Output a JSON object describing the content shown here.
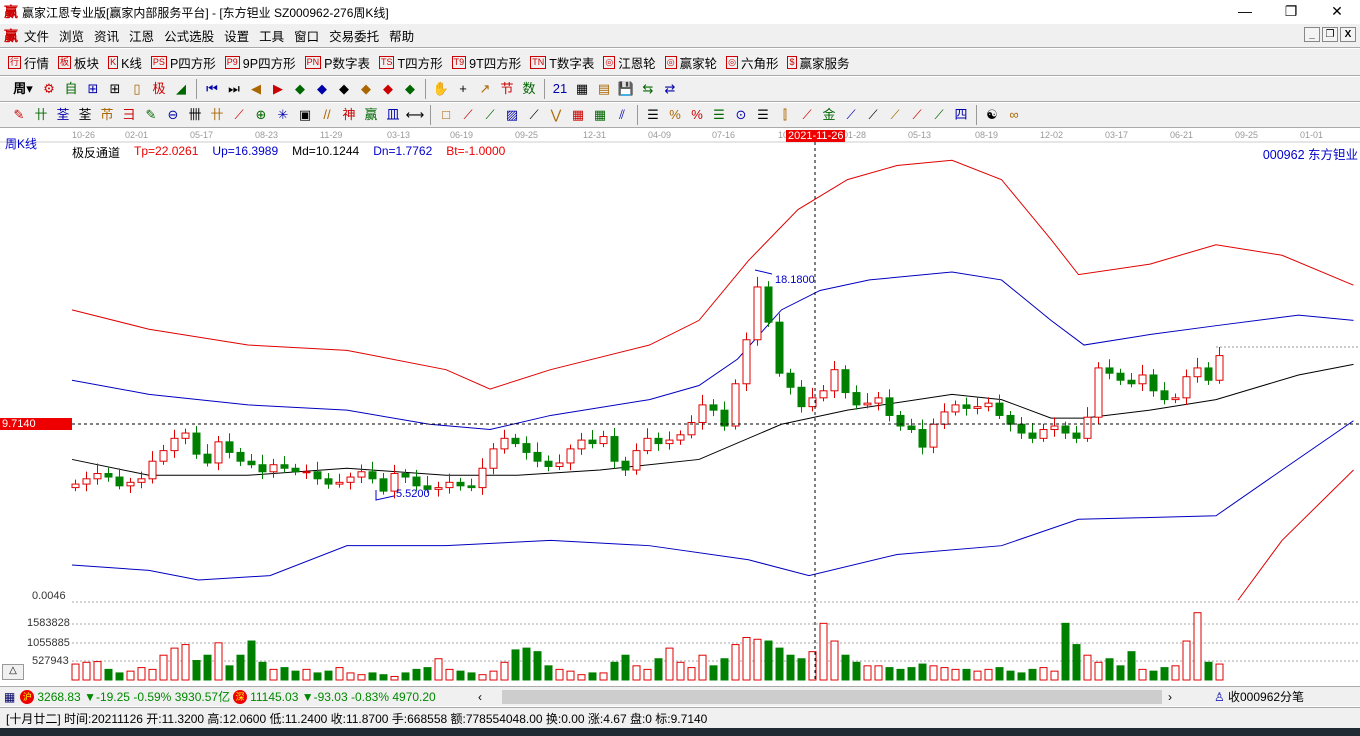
{
  "window": {
    "title": "赢家江恩专业版[赢家内部服务平台] - [东方钽业  SZ000962-276周K线]",
    "min": "—",
    "max": "❐",
    "close": "✕"
  },
  "menu": [
    "文件",
    "浏览",
    "资讯",
    "江恩",
    "公式选股",
    "设置",
    "工具",
    "窗口",
    "交易委托",
    "帮助"
  ],
  "toolbar1": [
    {
      "icon": "行",
      "label": "行情"
    },
    {
      "icon": "板",
      "label": "板块"
    },
    {
      "icon": "K",
      "label": "K线"
    },
    {
      "icon": "PS",
      "label": "P四方形"
    },
    {
      "icon": "P9",
      "label": "9P四方形"
    },
    {
      "icon": "PN",
      "label": "P数字表"
    },
    {
      "icon": "TS",
      "label": "T四方形"
    },
    {
      "icon": "T9",
      "label": "9T四方形"
    },
    {
      "icon": "TN",
      "label": "T数字表"
    },
    {
      "icon": "◎",
      "label": "江恩轮"
    },
    {
      "icon": "◎",
      "label": "赢家轮"
    },
    {
      "icon": "◎",
      "label": "六角形"
    },
    {
      "icon": "$",
      "label": "赢家服务"
    }
  ],
  "toolbar2": {
    "period": "周",
    "icons": [
      "⚙",
      "自",
      "⊞",
      "⊞",
      "▯",
      "极",
      "◢",
      "⏮",
      "⏭",
      "◀",
      "▶",
      "◆",
      "◆",
      "◆",
      "◆",
      "◆",
      "◆",
      "✋",
      "+",
      "↗",
      "节",
      "数",
      "21",
      "▦",
      "▤",
      "💾",
      "⇆",
      "⇄"
    ]
  },
  "toolbar3": {
    "icons": [
      "✎",
      "卄",
      "荃",
      "荃",
      "芇",
      "彐",
      "✎",
      "⊖",
      "卌",
      "卄",
      "⟋",
      "⊕",
      "✳",
      "▣",
      "//",
      "神",
      "赢",
      "皿",
      "⟷",
      "□",
      "⟋",
      "⟋",
      "▨",
      "⟋",
      "⋁",
      "▦",
      "▦",
      "⫽",
      "☰",
      "%",
      "%",
      "☰",
      "⊙",
      "☰",
      "⫿",
      "⟋",
      "金",
      "⟋",
      "⟋",
      "⟋",
      "⟋",
      "⟋",
      "四",
      "☯",
      "∞"
    ]
  },
  "chart": {
    "period_label": "周K线",
    "indicator": "极反通道",
    "tp": "Tp=22.0261",
    "up": "Up=16.3989",
    "md": "Md=10.1244",
    "dn": "Dn=1.7762",
    "bt": "Bt=-1.0000",
    "stock": "000962  东方钽业",
    "cursor_date": "2021-11-26",
    "cursor_price": "9.7140",
    "high_label": "18.1800",
    "low_label": "5.5200",
    "vol_axis": [
      "0.0046",
      "1583828",
      "1055885",
      "527943"
    ],
    "date_ticks": [
      "10-26",
      "02-01",
      "05-17",
      "08-23",
      "11-29",
      "03-13",
      "06-19",
      "09-25",
      "12-31",
      "04-09",
      "07-16",
      "10",
      "01-28",
      "05-13",
      "08-19",
      "12-02",
      "03-17",
      "06-21",
      "09-25",
      "01-01"
    ]
  },
  "chart_data": {
    "type": "candlestick",
    "closes": [
      6.3,
      6.6,
      6.9,
      6.7,
      6.2,
      6.4,
      6.6,
      7.6,
      8.2,
      8.9,
      9.2,
      8.0,
      7.5,
      8.7,
      8.1,
      7.6,
      7.4,
      7.0,
      7.4,
      7.2,
      7.0,
      7.0,
      6.6,
      6.3,
      6.4,
      6.7,
      7.0,
      6.6,
      5.9,
      6.9,
      6.7,
      6.2,
      6.0,
      6.1,
      6.4,
      6.2,
      6.1,
      7.2,
      8.3,
      8.9,
      8.6,
      8.1,
      7.6,
      7.3,
      7.5,
      8.3,
      8.8,
      8.6,
      9.0,
      7.6,
      7.1,
      8.2,
      8.9,
      8.6,
      8.8,
      9.1,
      9.8,
      10.8,
      10.5,
      9.6,
      12.0,
      14.5,
      17.5,
      15.5,
      12.6,
      11.8,
      10.7,
      11.2,
      11.6,
      12.8,
      11.5,
      10.8,
      10.9,
      11.2,
      10.2,
      9.6,
      9.4,
      8.4,
      9.7,
      10.4,
      10.8,
      10.6,
      10.7,
      10.9,
      10.2,
      9.7,
      9.2,
      8.9,
      9.4,
      9.6,
      9.2,
      8.9,
      10.1,
      12.9,
      12.6,
      12.2,
      12.0,
      12.5,
      11.6,
      11.1,
      11.2,
      12.4,
      12.9,
      12.2,
      13.6
    ],
    "volumes": [
      450000,
      500000,
      520000,
      300000,
      200000,
      250000,
      350000,
      300000,
      700000,
      900000,
      1000000,
      550000,
      700000,
      1050000,
      400000,
      700000,
      1100000,
      500000,
      300000,
      350000,
      250000,
      300000,
      200000,
      250000,
      350000,
      200000,
      150000,
      200000,
      150000,
      100000,
      200000,
      300000,
      350000,
      600000,
      300000,
      250000,
      200000,
      150000,
      250000,
      500000,
      850000,
      900000,
      800000,
      400000,
      300000,
      250000,
      150000,
      200000,
      200000,
      500000,
      700000,
      400000,
      300000,
      600000,
      900000,
      500000,
      350000,
      700000,
      400000,
      600000,
      1000000,
      1200000,
      1150000,
      1100000,
      900000,
      700000,
      600000,
      800000,
      1600000,
      1100000,
      700000,
      500000,
      400000,
      400000,
      350000,
      300000,
      350000,
      450000,
      400000,
      350000,
      300000,
      300000,
      250000,
      300000,
      350000,
      250000,
      200000,
      300000,
      350000,
      250000,
      1600000,
      1000000,
      700000,
      500000,
      600000,
      400000,
      800000,
      300000,
      250000,
      350000,
      400000,
      1100000,
      1900000,
      500000,
      450000
    ],
    "bands": {
      "tp": [
        [
          0,
          16.2
        ],
        [
          14,
          15.1
        ],
        [
          32,
          14.2
        ],
        [
          50,
          13.9
        ],
        [
          68,
          12.8
        ],
        [
          76,
          11.7
        ],
        [
          87,
          12.8
        ],
        [
          105,
          14.2
        ],
        [
          114,
          15.6
        ],
        [
          123,
          19.0
        ],
        [
          132,
          21.9
        ],
        [
          141,
          23.6
        ],
        [
          150,
          24.4
        ],
        [
          160,
          24.7
        ],
        [
          169,
          23.6
        ],
        [
          178,
          20.2
        ],
        [
          183,
          18.2
        ],
        [
          196,
          18.8
        ],
        [
          208,
          19.9
        ],
        [
          220,
          19.3
        ],
        [
          233,
          17.6
        ]
      ],
      "up": [
        [
          0,
          12.2
        ],
        [
          14,
          11.4
        ],
        [
          32,
          10.8
        ],
        [
          50,
          10.5
        ],
        [
          65,
          9.7
        ],
        [
          76,
          9.4
        ],
        [
          87,
          10.2
        ],
        [
          105,
          11.1
        ],
        [
          114,
          11.9
        ],
        [
          121,
          13.4
        ],
        [
          129,
          16.2
        ],
        [
          136,
          17.3
        ],
        [
          145,
          17.9
        ],
        [
          160,
          18.35
        ],
        [
          169,
          17.9
        ],
        [
          178,
          15.6
        ],
        [
          184,
          14.2
        ],
        [
          196,
          14.8
        ],
        [
          208,
          15.3
        ],
        [
          223,
          15.9
        ],
        [
          233,
          15.6
        ]
      ],
      "md": [
        [
          0,
          7.7
        ],
        [
          14,
          6.8
        ],
        [
          32,
          6.8
        ],
        [
          50,
          7.2
        ],
        [
          68,
          6.8
        ],
        [
          81,
          6.8
        ],
        [
          96,
          7.1
        ],
        [
          114,
          7.7
        ],
        [
          129,
          9.7
        ],
        [
          141,
          10.5
        ],
        [
          160,
          11.4
        ],
        [
          169,
          11.1
        ],
        [
          178,
          10.05
        ],
        [
          184,
          10.05
        ],
        [
          196,
          10.5
        ],
        [
          208,
          11.1
        ],
        [
          223,
          12.5
        ],
        [
          233,
          13.1
        ]
      ],
      "dn": [
        [
          0,
          1.7
        ],
        [
          14,
          1.4
        ],
        [
          23,
          0.85
        ],
        [
          36,
          1.1
        ],
        [
          50,
          2.8
        ],
        [
          68,
          2.8
        ],
        [
          87,
          3.1
        ],
        [
          105,
          2.8
        ],
        [
          123,
          2.0
        ],
        [
          134,
          1.1
        ],
        [
          150,
          2.3
        ],
        [
          169,
          2.8
        ],
        [
          183,
          4.3
        ],
        [
          196,
          4.4
        ],
        [
          208,
          4.5
        ],
        [
          220,
          7.1
        ],
        [
          233,
          9.9
        ]
      ],
      "bt": [
        [
          212,
          -0.3
        ],
        [
          220,
          3.1
        ],
        [
          233,
          7.1
        ]
      ]
    },
    "ylim": [
      -0.3,
      25.6
    ]
  },
  "status": {
    "sh_value": "3268.83",
    "sh_change": "▼-19.25",
    "sh_pct": "-0.59%",
    "sh_amount": "3930.57亿",
    "sz_value": "11145.03",
    "sz_change": "▼-93.03",
    "sz_pct": "-0.83%",
    "sz_amount": "4970.20",
    "sh_badge": "沪",
    "sz_badge": "深",
    "right": "收000962分笔",
    "info": "[十月廿二] 时间:20211126 开:11.3200 高:12.0600 低:11.2400 收:11.8700 手:668558 额:778554048.00 换:0.00 涨:4.67 盘:0 标:9.7140"
  },
  "colors": {
    "up": "#e00000",
    "down": "#008000",
    "tp": "#e00000",
    "band": "#0000c0",
    "md": "#000000"
  }
}
